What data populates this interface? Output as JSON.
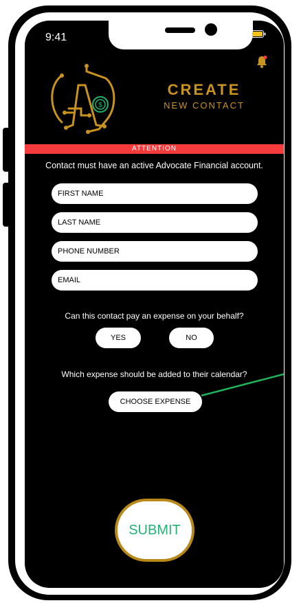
{
  "status_bar": {
    "time": "9:41"
  },
  "header": {
    "title_line1": "CREATE",
    "title_line2": "NEW CONTACT"
  },
  "attention": {
    "label": "ATTENTION",
    "message": "Contact must have an active Advocate Financial account."
  },
  "form": {
    "first_name_placeholder": "FIRST NAME",
    "last_name_placeholder": "LAST NAME",
    "phone_placeholder": "PHONE NUMBER",
    "email_placeholder": "EMAIL"
  },
  "pay_question": {
    "text": "Can this contact pay an expense on your behalf?",
    "yes_label": "YES",
    "no_label": "NO"
  },
  "expense_question": {
    "text": "Which expense should be added to their calendar?",
    "button_label": "CHOOSE EXPENSE"
  },
  "submit_label": "SUBMIT",
  "colors": {
    "gold": "#c9931f",
    "alert_red": "#f53b3b",
    "submit_green": "#22b273",
    "arrow_green": "#1fb35a"
  },
  "icons": [
    "bell-icon",
    "signal-icon",
    "wifi-icon",
    "battery-icon",
    "brand-logo"
  ]
}
